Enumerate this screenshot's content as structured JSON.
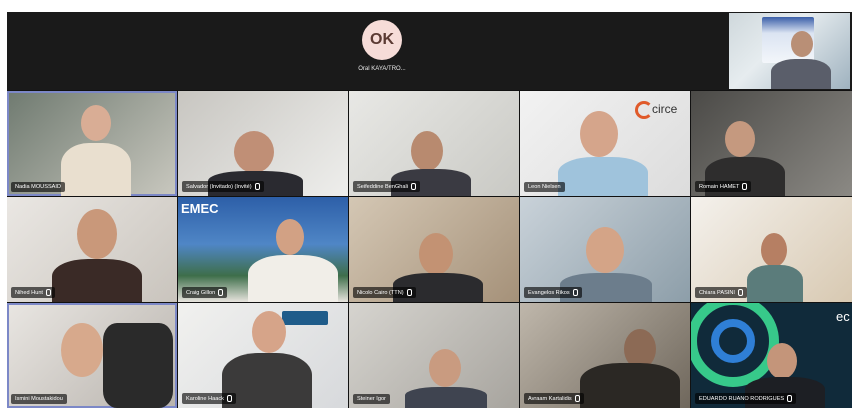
{
  "top": {
    "avatar_initials": "OK",
    "avatar_name": "Oral KAYA/TRO..."
  },
  "participants": [
    {
      "name": "Nadia MOUSSAID",
      "mic": false
    },
    {
      "name": "Salvador (Invitado) (Invité)",
      "mic": true
    },
    {
      "name": "Seifeddine BenGhali",
      "mic": true
    },
    {
      "name": "Leon Nielsen",
      "mic": false
    },
    {
      "name": "Romain HAMET",
      "mic": true
    },
    {
      "name": "Nihed Hunt",
      "mic": true
    },
    {
      "name": "Craig Gillon",
      "mic": true
    },
    {
      "name": "Nicolo Cairo (TTN)",
      "mic": true
    },
    {
      "name": "Evangelos Rikos",
      "mic": true
    },
    {
      "name": "Chiara PASINI",
      "mic": true
    },
    {
      "name": "Ismini Moustakidou",
      "mic": false
    },
    {
      "name": "Karoline Haack",
      "mic": true
    },
    {
      "name": "Steiner Igor",
      "mic": false
    },
    {
      "name": "Avraam Kartalidis",
      "mic": true
    },
    {
      "name": "EDUARDO RUANO RODRIGUES",
      "mic": true
    }
  ],
  "brands": {
    "circe": "circe",
    "emec": "EMEC",
    "ec": "ec"
  }
}
